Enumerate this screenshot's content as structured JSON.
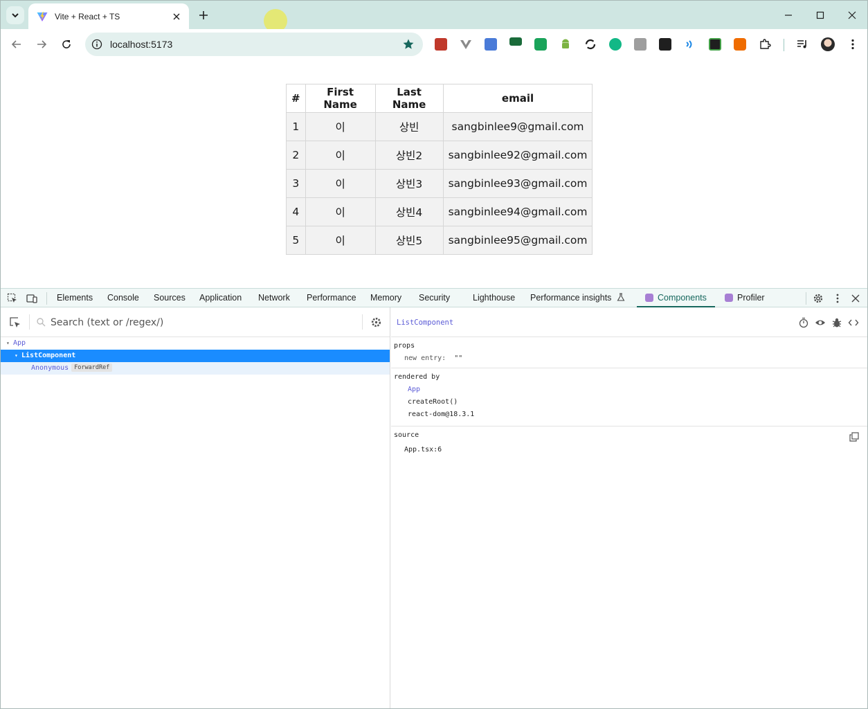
{
  "browser": {
    "tab_title": "Vite + React + TS",
    "url": "localhost:5173",
    "accent": "#16675d"
  },
  "page": {
    "table": {
      "headers": [
        "#",
        "First Name",
        "Last Name",
        "email"
      ],
      "rows": [
        [
          "1",
          "이",
          "상빈",
          "sangbinlee9@gmail.com"
        ],
        [
          "2",
          "이",
          "상빈2",
          "sangbinlee92@gmail.com"
        ],
        [
          "3",
          "이",
          "상빈3",
          "sangbinlee93@gmail.com"
        ],
        [
          "4",
          "이",
          "상빈4",
          "sangbinlee94@gmail.com"
        ],
        [
          "5",
          "이",
          "상빈5",
          "sangbinlee95@gmail.com"
        ]
      ]
    }
  },
  "devtools": {
    "tabs": [
      "Elements",
      "Console",
      "Sources",
      "Application",
      "Network",
      "Performance",
      "Memory",
      "Security",
      "Lighthouse",
      "Performance insights",
      "Components",
      "Profiler"
    ],
    "active_tab": "Components",
    "search_placeholder": "Search (text or /regex/)",
    "tree": {
      "app": "App",
      "selected": "ListComponent",
      "child": "Anonymous",
      "child_badge": "ForwardRef"
    },
    "inspector": {
      "component_name": "ListComponent",
      "props_label": "props",
      "prop_key": "new entry:",
      "prop_value": "\"\"",
      "rendered_by_label": "rendered by",
      "rendered_by": [
        "App",
        "createRoot()",
        "react-dom@18.3.1"
      ],
      "source_label": "source",
      "source_value": "App.tsx:6"
    }
  }
}
